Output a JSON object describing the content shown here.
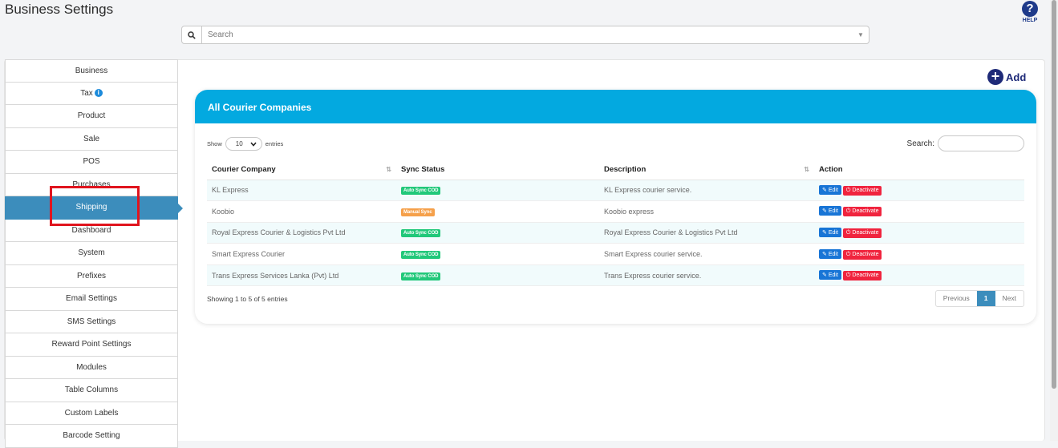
{
  "page": {
    "title": "Business Settings",
    "help_icon": "question-circle-icon",
    "help_label": "HELP"
  },
  "search": {
    "placeholder": "Search",
    "icon": "search-icon"
  },
  "sidebar": {
    "items": [
      {
        "label": "Business"
      },
      {
        "label": "Tax",
        "badge": "i"
      },
      {
        "label": "Product"
      },
      {
        "label": "Sale"
      },
      {
        "label": "POS"
      },
      {
        "label": "Purchases"
      },
      {
        "label": "Shipping",
        "active": true
      },
      {
        "label": "Dashboard"
      },
      {
        "label": "System"
      },
      {
        "label": "Prefixes"
      },
      {
        "label": "Email Settings"
      },
      {
        "label": "SMS Settings"
      },
      {
        "label": "Reward Point Settings"
      },
      {
        "label": "Modules"
      },
      {
        "label": "Table Columns"
      },
      {
        "label": "Custom Labels"
      },
      {
        "label": "Barcode Setting"
      }
    ]
  },
  "add_button": {
    "label": "Add",
    "icon": "plus-circle-icon"
  },
  "card": {
    "title": "All Courier Companies",
    "header_color": "#03a9e0"
  },
  "controls": {
    "show_label": "Show",
    "entries_value": "10",
    "entries_label": "entries",
    "search_label": "Search:"
  },
  "table": {
    "columns": [
      "Courier Company",
      "Sync Status",
      "Description",
      "Action"
    ],
    "rows": [
      {
        "company": "KL Express",
        "sync": "Auto Sync COD",
        "sync_type": "auto",
        "description": "KL Express courier service."
      },
      {
        "company": "Koobio",
        "sync": "Manual Sync",
        "sync_type": "manual",
        "description": "Koobio express"
      },
      {
        "company": "Royal Express Courier & Logistics Pvt Ltd",
        "sync": "Auto Sync COD",
        "sync_type": "auto",
        "description": "Royal Express Courier & Logistics Pvt Ltd"
      },
      {
        "company": "Smart Express Courier",
        "sync": "Auto Sync COD",
        "sync_type": "auto",
        "description": "Smart Express courier service."
      },
      {
        "company": "Trans Express Services Lanka (Pvt) Ltd",
        "sync": "Auto Sync COD",
        "sync_type": "auto",
        "description": "Trans Express courier service."
      }
    ],
    "edit_label": "Edit",
    "deactivate_label": "Deactivate"
  },
  "footer": {
    "showing": "Showing 1 to 5 of 5 entries",
    "previous": "Previous",
    "current_page": "1",
    "next": "Next"
  },
  "colors": {
    "accent": "#3c8dbc",
    "auto_sync": "#21c87a",
    "manual_sync": "#f5a04a",
    "edit": "#1875d6",
    "deactivate": "#f0243e",
    "highlight": "#e0141e"
  }
}
